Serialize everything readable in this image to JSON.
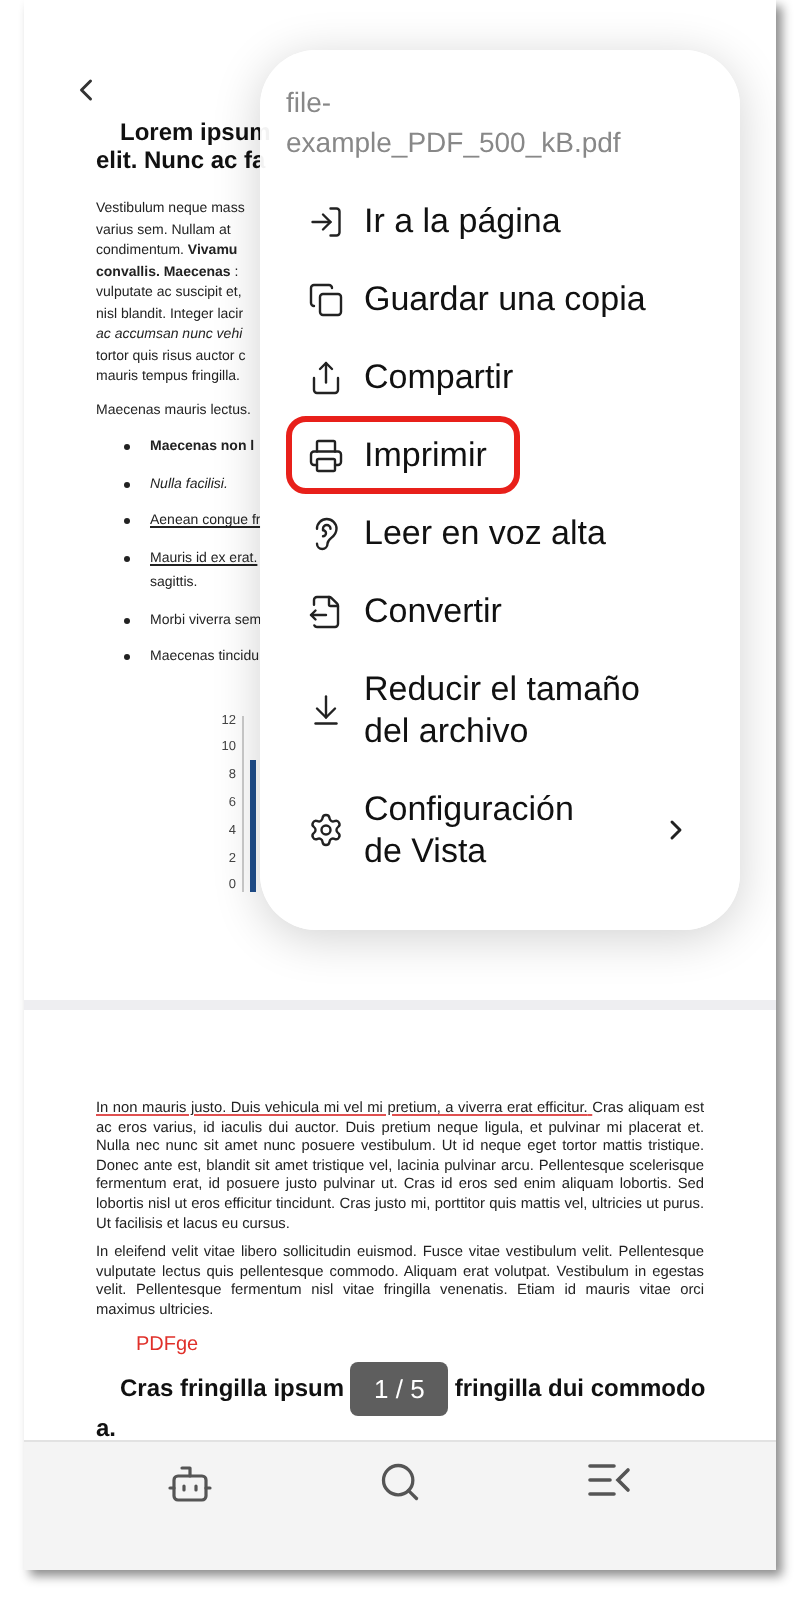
{
  "page_1": {
    "title_lines": [
      "Lorem ipsum",
      "elit. Nunc ac fa"
    ],
    "paragraph_lines": [
      "Vestibulum neque mass",
      "varius sem. Nullam at",
      "condimentum.  **Vivamu**",
      "**convallis. Maecenas** :",
      "vulputate ac suscipit et,",
      "nisl blandit. Integer lacir",
      "*ac accumsan nunc vehi*",
      "tortor quis risus auctor c",
      "mauris tempus fringilla."
    ],
    "paragraph_2": "Maecenas mauris lectus.",
    "bullets": [
      {
        "text": "Maecenas non l",
        "kind": "bold"
      },
      {
        "text": "Nulla facilisi.",
        "kind": "italic"
      },
      {
        "text": "Aenean congue fr",
        "kind": "underline"
      },
      {
        "text": "Mauris id ex erat.",
        "continuation": "sagittis.",
        "kind": "underline"
      },
      {
        "text": "Morbi viverra sem",
        "kind": "plain"
      },
      {
        "text": "Maecenas tincidu",
        "kind": "plain"
      }
    ],
    "chart_axis_labels": [
      "12",
      "10",
      "8",
      "6",
      "4",
      "2",
      "0"
    ]
  },
  "page_2": {
    "paragraphs": [
      {
        "lead": "In non mauris justo. Duis vehicula mi vel mi pretium, a viverra erat efficitur.",
        "text": "Cras aliquam est ac eros varius, id iaculis dui auctor. Duis pretium neque ligula, et pulvinar mi placerat et. Nulla nec nunc sit amet nunc posuere vestibulum. Ut id neque eget tortor mattis tristique. Donec ante est, blandit sit amet tristique vel, lacinia pulvinar arcu. Pellentesque scelerisque fermentum erat, id posuere justo pulvinar ut. Cras id eros sed enim aliquam lobortis. Sed lobortis nisl ut eros efficitur tincidunt. Cras justo mi, porttitor quis mattis vel, ultricies ut purus. Ut facilisis et lacus eu cursus."
      },
      {
        "text": "In eleifend velit vitae libero sollicitudin euismod. Fusce vitae vestibulum velit. Pellentesque vulputate lectus quis pellentesque commodo. Aliquam erat volutpat. Vestibulum in egestas velit. Pellentesque fermentum nisl vitae fringilla venenatis. Etiam id mauris vitae orci maximus ultricies."
      }
    ],
    "stamp": "PDFge",
    "heading_left": "Cras fringilla ipsum",
    "heading_right": "fringilla dui commodo",
    "heading_end": "a."
  },
  "page_indicator": "1 / 5",
  "menu": {
    "title_lines": [
      "file-",
      "example_PDF_500_kB.pdf"
    ],
    "items": [
      {
        "kind": "goto",
        "label": "Ir a la página",
        "highlighted": false,
        "submenu": false
      },
      {
        "kind": "copy",
        "label": "Guardar una copia",
        "highlighted": false,
        "submenu": false
      },
      {
        "kind": "share",
        "label": "Compartir",
        "highlighted": false,
        "submenu": false
      },
      {
        "kind": "print",
        "label": "Imprimir",
        "highlighted": true,
        "submenu": false
      },
      {
        "kind": "ear",
        "label": "Leer en voz alta",
        "highlighted": false,
        "submenu": false
      },
      {
        "kind": "convert",
        "label": "Convertir",
        "highlighted": false,
        "submenu": false
      },
      {
        "kind": "compress",
        "label": "Reducir el tamaño\ndel archivo",
        "highlighted": false,
        "submenu": false
      },
      {
        "kind": "settings",
        "label": "Configuración\nde Vista",
        "highlighted": false,
        "submenu": true
      }
    ]
  },
  "bottom_bar": [
    {
      "kind": "bot"
    },
    {
      "kind": "search"
    },
    {
      "kind": "outline"
    }
  ]
}
